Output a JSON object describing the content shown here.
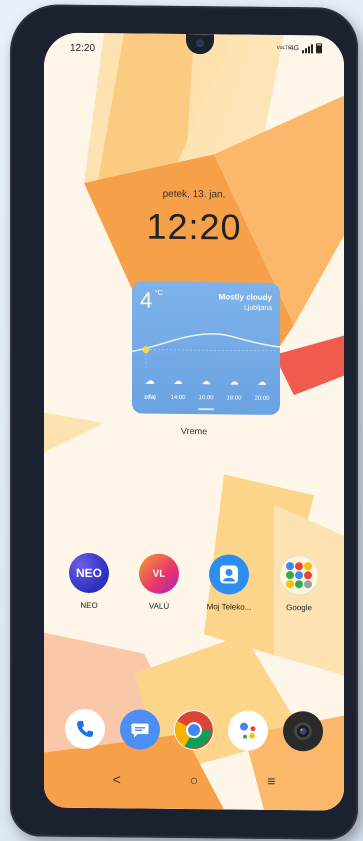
{
  "status_bar": {
    "time": "12:20",
    "lte": "VoLTE",
    "network": "4G"
  },
  "lockscreen": {
    "date": "petek, 13. jan.",
    "clock": "12:20"
  },
  "weather_widget": {
    "temperature": "4",
    "unit": "°C",
    "condition": "Mostly cloudy",
    "city": "Ljubljana",
    "hours": [
      {
        "label": "zdaj",
        "icon": "cloud-rain-icon"
      },
      {
        "label": "14:00",
        "icon": "cloud-icon"
      },
      {
        "label": "16:00",
        "icon": "cloud-icon"
      },
      {
        "label": "18:00",
        "icon": "cloud-icon"
      },
      {
        "label": "20:00",
        "icon": "cloud-icon"
      }
    ],
    "widget_label": "Vreme"
  },
  "apps": [
    {
      "label": "NEO",
      "icon": "neo-app-icon",
      "glyph": "NEO"
    },
    {
      "label": "VALÚ",
      "icon": "valu-app-icon",
      "glyph": "VL"
    },
    {
      "label": "Moj Teleko...",
      "icon": "moj-telekom-app-icon"
    },
    {
      "label": "Google",
      "icon": "google-folder-icon"
    }
  ],
  "dock": [
    {
      "icon": "phone-app-icon"
    },
    {
      "icon": "messages-app-icon"
    },
    {
      "icon": "chrome-app-icon"
    },
    {
      "icon": "google-assistant-app-icon"
    },
    {
      "icon": "camera-app-icon"
    }
  ],
  "navigation": {
    "back": "<",
    "home": "○",
    "recents": "≡"
  },
  "colors": {
    "wallpaper_orange": "#f6a04a",
    "wallpaper_yellow": "#fcd58a",
    "wallpaper_red": "#ef5b4c",
    "weather_blue": "#6aa3e2"
  }
}
